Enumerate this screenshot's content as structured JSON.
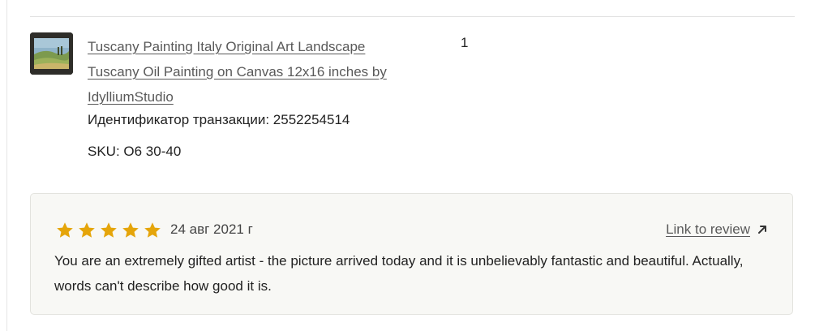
{
  "item": {
    "thumbnail": "landscape-painting-thumbnail",
    "title": "Tuscany Painting Italy Original Art Landscape Tuscany Oil Painting on Canvas 12x16 inches by IdylliumStudio",
    "transaction_id_text": "Идентификатор транзакции: 2552254514",
    "sku_text": "SKU: O6 30-40",
    "quantity": "1"
  },
  "review": {
    "rating": 5,
    "max_rating": 5,
    "star_color": "#e5a50a",
    "date": "24 авг 2021 г",
    "link_label": "Link to review",
    "link_icon": "arrow-up-right-icon",
    "text": "You are an extremely gifted artist - the picture arrived today and it is unbelievably fantastic and beautiful. Actually, words can't describe how good it is."
  }
}
